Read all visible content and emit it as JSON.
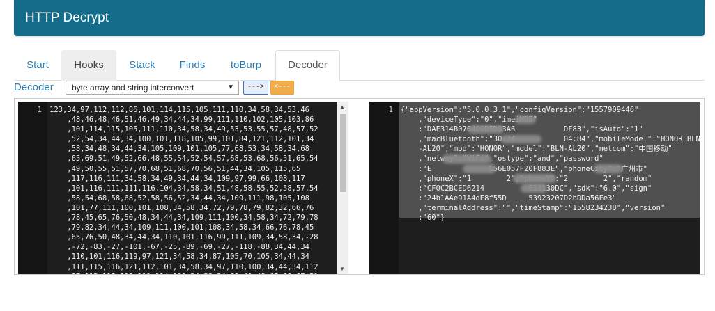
{
  "app": {
    "title": "HTTP Decrypt"
  },
  "tabs": [
    "Start",
    "Hooks",
    "Stack",
    "Finds",
    "toBurp",
    "Decoder"
  ],
  "decoder": {
    "label": "Decoder",
    "mode_selected": "byte array and string interconvert",
    "to_right_label": "--->",
    "to_left_label": "<---"
  },
  "left_editor": {
    "line_number": "1",
    "lines": [
      "123,34,97,112,112,86,101,114,115,105,111,110,34,58,34,53,46",
      "    ,48,46,48,46,51,46,49,34,44,34,99,111,110,102,105,103,86",
      "    ,101,114,115,105,111,110,34,58,34,49,53,53,55,57,48,57,52",
      "    ,52,54,34,44,34,100,101,118,105,99,101,84,121,112,101,34",
      "    ,58,34,48,34,44,34,105,109,101,105,77,68,53,34,58,34,68",
      "    ,65,69,51,49,52,66,48,55,54,52,54,57,68,53,68,56,51,65,54",
      "    ,49,50,55,51,57,70,68,51,68,70,56,51,44,34,105,115,65",
      "    ,117,116,111,34,58,34,49,34,44,34,109,97,99,66,108,117",
      "    ,101,116,111,111,116,104,34,58,34,51,48,58,55,52,58,57,54",
      "    ,58,54,68,58,68,52,58,56,52,34,44,34,109,111,98,105,108",
      "    ,101,77,111,100,101,108,34,58,34,72,79,78,79,82,32,66,76",
      "    ,78,45,65,76,50,48,34,44,34,109,111,100,34,58,34,72,79,78",
      "    ,79,82,34,44,34,109,111,100,101,108,34,58,34,66,76,78,45",
      "    ,65,76,50,48,34,44,34,110,101,116,99,111,109,34,58,34,-28",
      "    ,-72,-83,-27,-101,-67,-25,-89,-69,-27,-118,-88,34,44,34",
      "    ,110,101,116,119,97,121,34,58,34,87,105,70,105,34,44,34",
      "    ,111,115,116,121,112,101,34,58,34,97,110,100,34,44,34,112",
      "    ,97,115,115,119,111,114,100,34,58,34,69,49,48,65,68,67,51"
    ]
  },
  "right_editor": {
    "line_number": "1",
    "lines": [
      "{\"appVersion\":\"5.0.0.3.1\",\"configVersion\":\"1557909446\"",
      "    ,\"deviceType\":\"0\",\"imeiMD5\"",
      "    :\"DAE314B076469D5D83A6           DF83\",\"isAuto\":\"1\"",
      "    ,\"macBluetooth\":\"30:74           04:84\",\"mobileModel\":\"HONOR BLN",
      "    -AL20\",\"mod\":\"HONOR\",\"model\":\"BLN-AL20\",\"netcom\":\"中国移动\"",
      "    ,\"netway\":\"WiFi\",\"ostype\":\"and\",\"password\"",
      "    :\"E             E56E057F20F883E\",\"phoneCity\":\"广州市\"",
      "    ,\"phoneX\":\"1        2\",\"phoneY\":\"2        2\",\"random\"",
      "    :\"CF0C2BCED6214          E13130DC\",\"sdk\":\"6.0\",\"sign\"",
      "    :\"24b1AAe91A4dE8f55D     53923207D2bDDa56Fe3\"",
      "    ,\"terminalAddress\":\"\",\"timeStamp\":\"1558234238\",\"version\"",
      "    :\"60\"}"
    ]
  },
  "colors": {
    "header_bg": "#126c8a",
    "editor_bg": "#1e1e1e",
    "selection_bg": "#505050",
    "accent_orange": "#f0ad4e",
    "link_blue": "#2a7bb0"
  }
}
